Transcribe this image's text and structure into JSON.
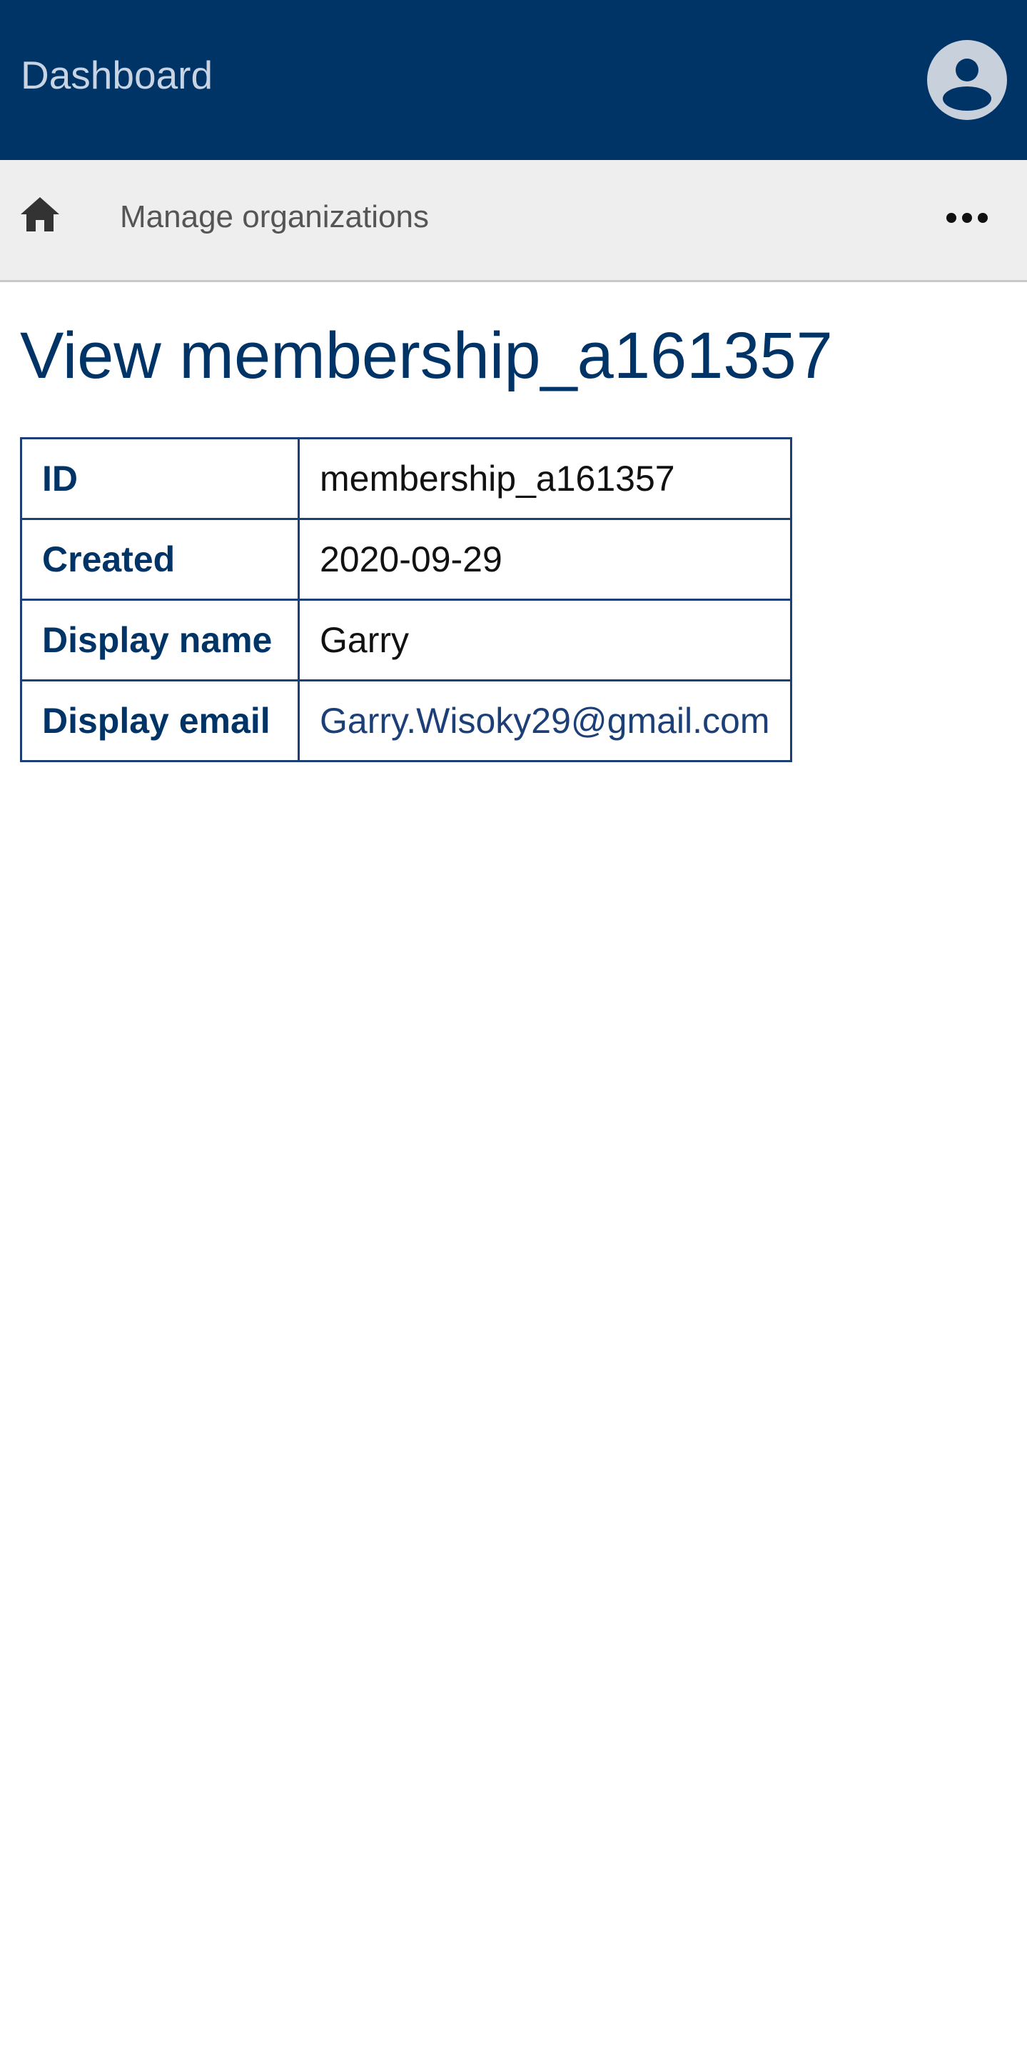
{
  "header": {
    "title": "Dashboard",
    "avatar_icon": "user-circle-icon",
    "bg_color": "#003366"
  },
  "nav": {
    "home_icon": "home-icon",
    "link_label": "Manage organizations",
    "more_icon": "ellipsis-icon"
  },
  "page": {
    "title": "View membership_a161357"
  },
  "details": {
    "rows": [
      {
        "label": "ID",
        "value": "membership_a161357"
      },
      {
        "label": "Created",
        "value": "2020-09-29"
      },
      {
        "label": "Display name",
        "value": "Garry"
      },
      {
        "label": "Display email",
        "value": "Garry.Wisoky29@gmail.com"
      }
    ]
  }
}
